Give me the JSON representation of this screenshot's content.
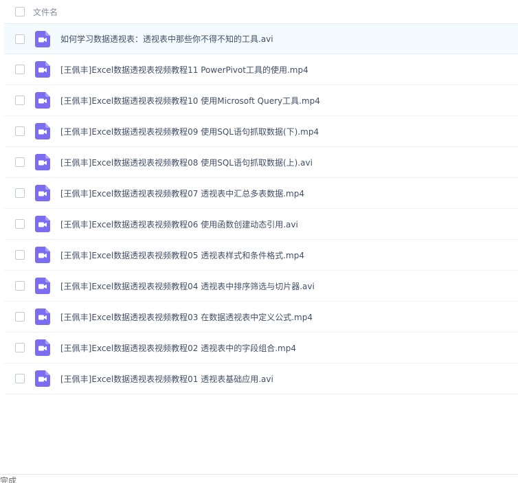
{
  "header": {
    "column_label": "文件名"
  },
  "files": [
    {
      "name": "如何学习数据透视表：透视表中那些你不得不知的工具.avi"
    },
    {
      "name": "[王佩丰]Excel数据透视表视频教程11 PowerPivot工具的使用.mp4"
    },
    {
      "name": "[王佩丰]Excel数据透视表视频教程10 使用Microsoft Query工具.mp4"
    },
    {
      "name": "[王佩丰]Excel数据透视表视频教程09 使用SQL语句抓取数据(下).mp4"
    },
    {
      "name": "[王佩丰]Excel数据透视表视频教程08 使用SQL语句抓取数据(上).avi"
    },
    {
      "name": "[王佩丰]Excel数据透视表视频教程07 透视表中汇总多表数据.mp4"
    },
    {
      "name": "[王佩丰]Excel数据透视表视频教程06 使用函数创建动态引用.avi"
    },
    {
      "name": "[王佩丰]Excel数据透视表视频教程05 透视表样式和条件格式.mp4"
    },
    {
      "name": "[王佩丰]Excel数据透视表视频教程04 透视表中排序筛选与切片器.avi"
    },
    {
      "name": "[王佩丰]Excel数据透视表视频教程03 在数据透视表中定义公式.mp4"
    },
    {
      "name": "[王佩丰]Excel数据透视表视频教程02 透视表中的字段组合.mp4"
    },
    {
      "name": "[王佩丰]Excel数据透视表视频教程01 透视表基础应用.avi"
    }
  ],
  "icons": {
    "file_icon": "video-file-icon",
    "icon_color": "#7b6cf0"
  },
  "status_bar": {
    "text": "完成"
  }
}
